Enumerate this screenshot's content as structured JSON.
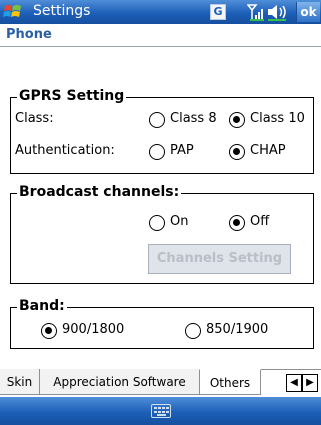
{
  "titlebar": {
    "title": "Settings",
    "gprs_indicator": "G",
    "ok_label": "ok",
    "icons": [
      "windows-start-icon",
      "gprs-icon",
      "signal-icon",
      "volume-icon"
    ]
  },
  "page": {
    "title": "Phone"
  },
  "gprs": {
    "title": "GPRS Setting",
    "class_label": "Class:",
    "class_options": [
      {
        "label": "Class 8",
        "checked": false
      },
      {
        "label": "Class 10",
        "checked": true
      }
    ],
    "auth_label": "Authentication:",
    "auth_options": [
      {
        "label": "PAP",
        "checked": false
      },
      {
        "label": "CHAP",
        "checked": true
      }
    ]
  },
  "broadcast": {
    "title": "Broadcast channels:",
    "options": [
      {
        "label": "On",
        "checked": false
      },
      {
        "label": "Off",
        "checked": true
      }
    ],
    "button_label": "Channels Setting"
  },
  "band": {
    "title": "Band:",
    "options": [
      {
        "label": "900/1800",
        "checked": true
      },
      {
        "label": "850/1900",
        "checked": false
      }
    ]
  },
  "tabs": [
    {
      "label": "Skin"
    },
    {
      "label": "Appreciation Software"
    },
    {
      "label": "Others",
      "active": true
    }
  ],
  "tab_arrows": {
    "left": "◀",
    "right": "▶"
  },
  "menubar": {
    "icon": "keyboard-icon"
  },
  "colors": {
    "title_bar": "#1d5fb8",
    "page_title": "#2a5fa8",
    "disabled_button": "#dfe3ea"
  }
}
